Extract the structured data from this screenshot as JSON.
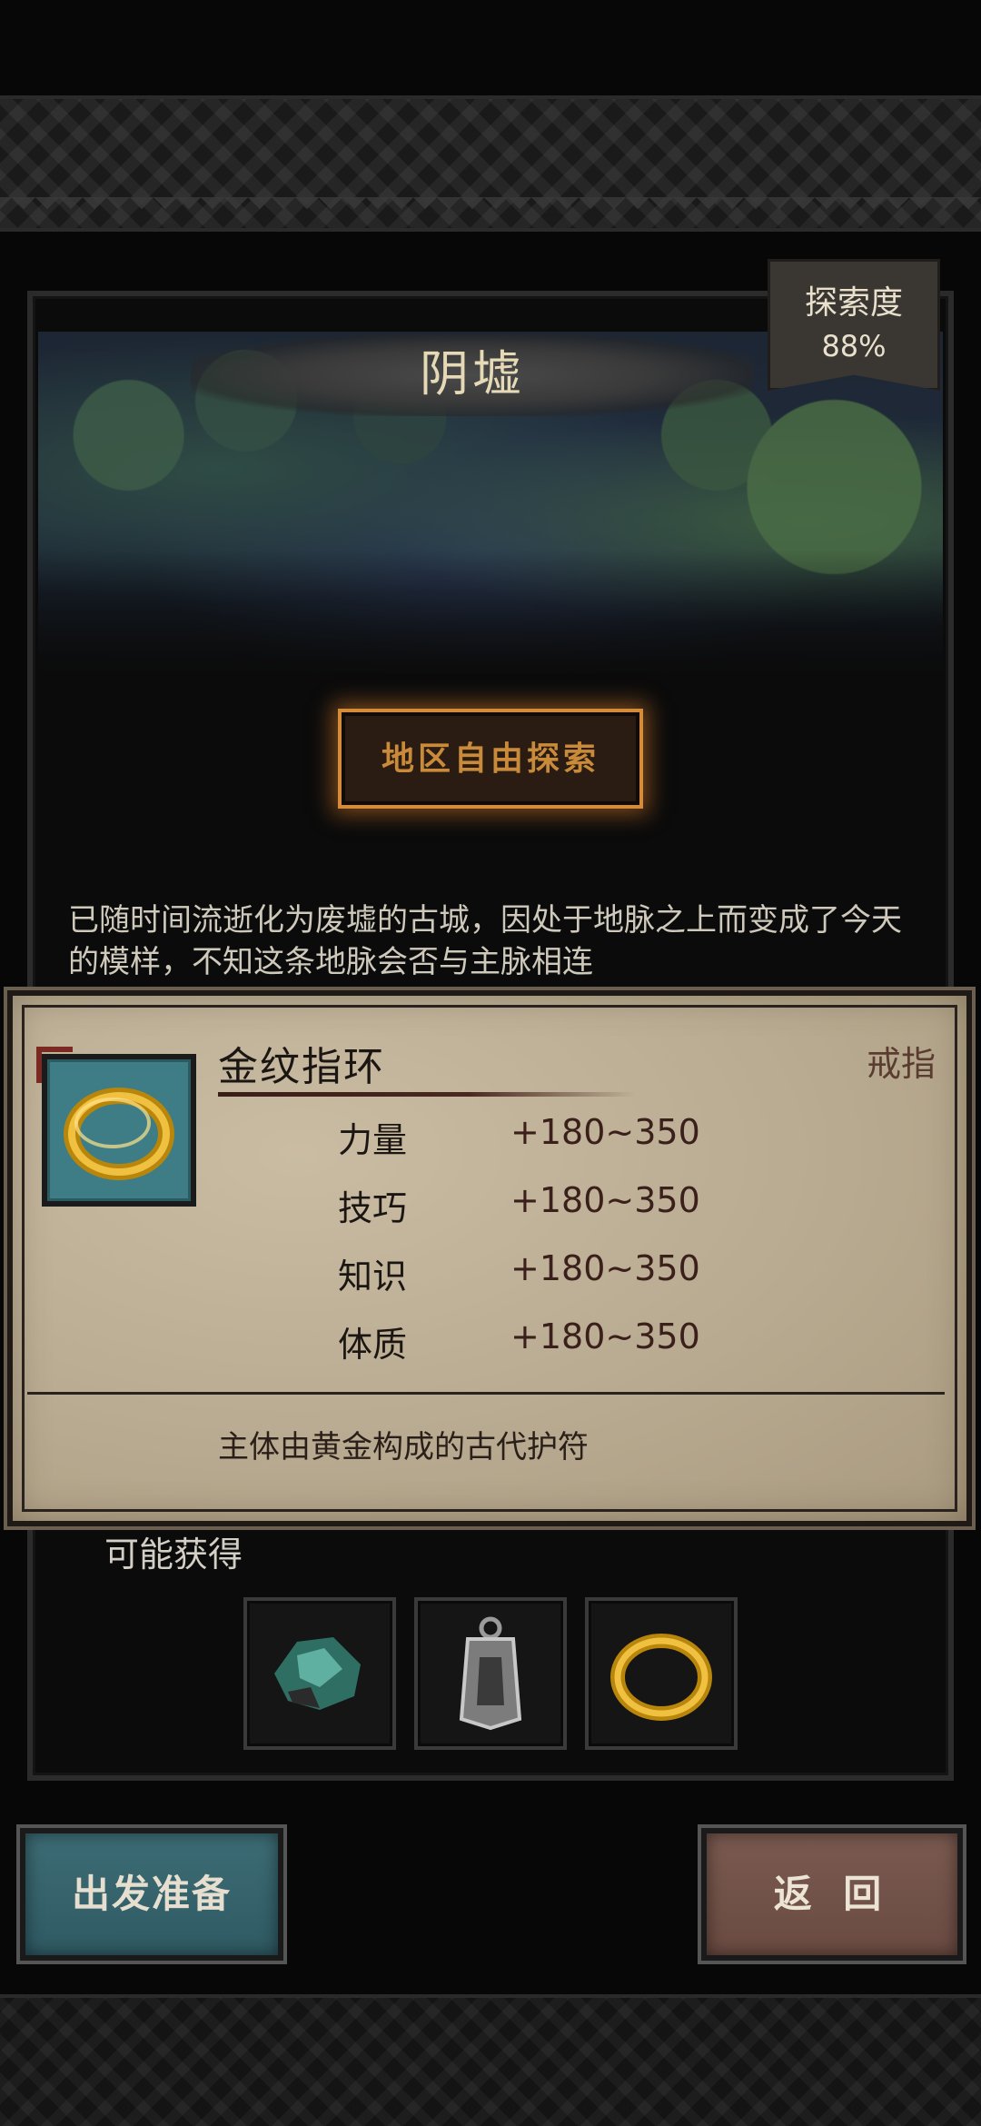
{
  "area": {
    "title": "阴墟",
    "exploration_label": "探索度",
    "exploration_value": "88%",
    "free_explore_button": "地区自由探索",
    "description": "已随时间流逝化为废墟的古城，因处于地脉之上而变成了今天的模样，不知这条地脉会否与主脉相连"
  },
  "tooltip": {
    "item_name": "金纹指环",
    "item_type": "戒指",
    "icon": "gold-ring-icon",
    "stats": [
      {
        "name": "力量",
        "value": "+180~350"
      },
      {
        "name": "技巧",
        "value": "+180~350"
      },
      {
        "name": "知识",
        "value": "+180~350"
      },
      {
        "name": "体质",
        "value": "+180~350"
      }
    ],
    "description": "主体由黄金构成的古代护符"
  },
  "rewards": {
    "label": "可能获得",
    "items": [
      {
        "icon": "green-ore-icon"
      },
      {
        "icon": "silver-talisman-icon"
      },
      {
        "icon": "gold-ring-icon"
      }
    ]
  },
  "buttons": {
    "depart": "出发准备",
    "back": "返 回"
  },
  "colors": {
    "free_explore_glow": "#d48b3a",
    "depart_bg": "#3d6c75",
    "back_bg": "#7a5a50",
    "card_bg": "#b9ab91"
  }
}
